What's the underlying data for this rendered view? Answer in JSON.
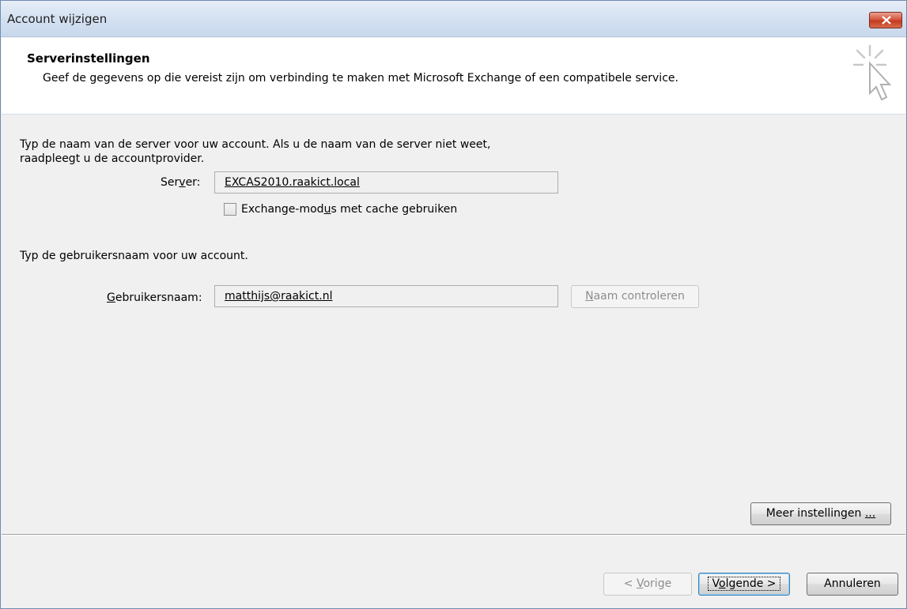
{
  "window": {
    "title": "Account wijzigen"
  },
  "header": {
    "title": "Serverinstellingen",
    "subtitle": "Geef de gegevens op die vereist zijn om verbinding te maken met Microsoft Exchange of een compatibele service."
  },
  "server_section": {
    "instruction_line1": "Typ de naam van de server voor uw account. Als u de naam van de server niet weet,",
    "instruction_line2": "raadpleegt u de accountprovider.",
    "server_label_pre": "Ser",
    "server_label_accel": "v",
    "server_label_post": "er:",
    "server_value": "EXCAS2010.raakict.local",
    "cache_label_pre": "Exchange-mod",
    "cache_label_accel": "u",
    "cache_label_post": "s met cache gebruiken",
    "cache_checked": false
  },
  "user_section": {
    "instruction": "Typ de gebruikersnaam voor uw account.",
    "username_label_accel": "G",
    "username_label_post": "ebruikersnaam:",
    "username_value": "matthijs@raakict.nl",
    "check_name_accel": "N",
    "check_name_post": "aam controleren"
  },
  "buttons": {
    "more_settings_pre": "Meer instellingen ",
    "more_settings_accel": "...",
    "back_pre": "< ",
    "back_accel": "V",
    "back_post": "orige",
    "next_pre": "V",
    "next_accel": "o",
    "next_post": "lgende >",
    "cancel": "Annuleren"
  },
  "icons": [
    "close-icon",
    "wizard-cursor-icon",
    "checkbox"
  ]
}
